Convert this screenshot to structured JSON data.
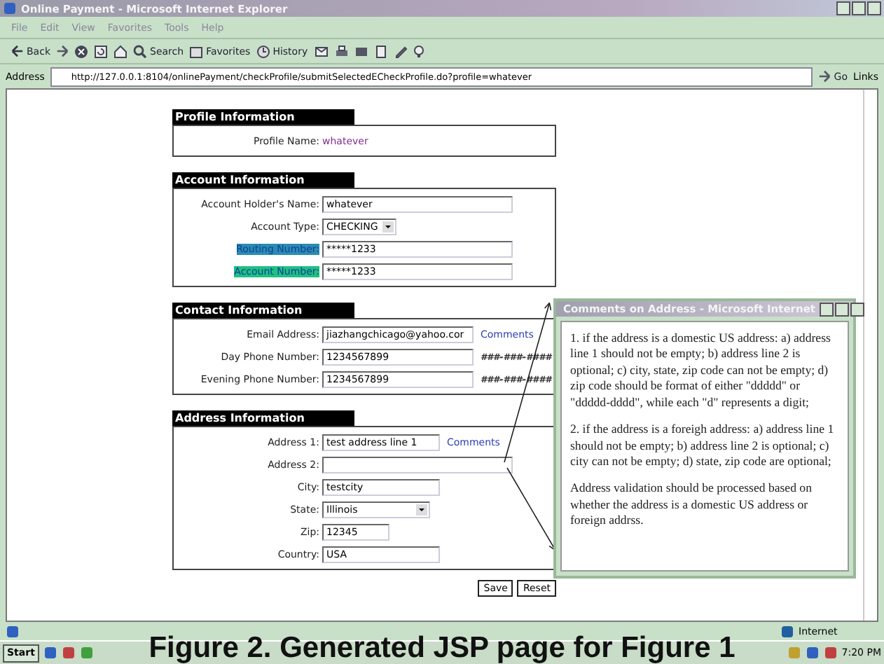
{
  "window": {
    "title": "Online Payment - Microsoft Internet Explorer"
  },
  "menu": [
    "File",
    "Edit",
    "View",
    "Favorites",
    "Tools",
    "Help"
  ],
  "toolbar": [
    {
      "kind": "back",
      "label": "Back"
    },
    {
      "kind": "forward"
    },
    {
      "kind": "stop"
    },
    {
      "kind": "refresh"
    },
    {
      "kind": "home"
    },
    {
      "kind": "search",
      "label": "Search"
    },
    {
      "kind": "favorites",
      "label": "Favorites"
    },
    {
      "kind": "history",
      "label": "History"
    },
    {
      "kind": "mail"
    },
    {
      "kind": "print"
    },
    {
      "kind": "edit"
    },
    {
      "kind": "discuss"
    },
    {
      "kind": "messenger"
    },
    {
      "kind": "tool"
    }
  ],
  "address_bar": {
    "label": "Address",
    "url": "http://127.0.0.1:8104/onlinePayment/checkProfile/submitSelectedECheckProfile.do?profile=whatever",
    "go": "Go",
    "links": "Links"
  },
  "sections": [
    {
      "title": "Profile Information",
      "fields": [
        {
          "kind": "static",
          "label": "Profile Name:",
          "value": "whatever"
        }
      ]
    },
    {
      "title": "Account Information",
      "fields": [
        {
          "kind": "long-input",
          "label": "Account Holder's Name:",
          "value": "whatever"
        },
        {
          "kind": "select",
          "label": "Account Type:",
          "value": "CHECKING"
        },
        {
          "kind": "long-input",
          "label": "Routing Number:",
          "value": "*****1233",
          "color": "#2a8cb0"
        },
        {
          "kind": "long-input",
          "label": "Account Number:",
          "value": "*****1233",
          "color": "#20c080"
        }
      ]
    },
    {
      "title": "Contact Information",
      "fields": [
        {
          "kind": "medium-input",
          "label": "Email Address:",
          "value": "jiazhangchicago@yahoo.cor",
          "link": "Comments"
        },
        {
          "kind": "medium-input",
          "label": "Day Phone Number:",
          "value": "1234567899",
          "hint": "###-###-####"
        },
        {
          "kind": "medium-input",
          "label": "Evening Phone Number:",
          "value": "1234567899",
          "hint": "###-###-####"
        }
      ]
    },
    {
      "title": "Address Information",
      "fields": [
        {
          "kind": "short-input",
          "label": "Address 1:",
          "value": "test address line 1",
          "link": "Comments"
        },
        {
          "kind": "long-input",
          "label": "Address 2:"
        },
        {
          "kind": "short-input",
          "label": "City:",
          "value": "testcity"
        },
        {
          "kind": "wide-select",
          "label": "State:",
          "value": "Illinois"
        },
        {
          "kind": "tiny-input",
          "label": "Zip:",
          "value": "12345"
        },
        {
          "kind": "short-input",
          "label": "Country:",
          "value": "USA"
        }
      ]
    }
  ],
  "buttons": [
    "Save",
    "Reset"
  ],
  "popup": {
    "title": "Comments on Address - Microsoft Internet",
    "paragraphs": [
      "1. if the address is a domestic US address: a) address line 1 should not be empty; b) address line 2 is optional; c) city, state, zip code can not be empty; d) zip code should be format of either \"ddddd\" or \"ddddd-dddd\", while each \"d\" represents a digit;",
      "2. if the address is a foreigh address: a) address line 1 should not be empty; b) address line 2 is optional; c) city can not be empty; d) state, zip code are optional;",
      "Address validation should be processed based on whether the address is a domestic US address or foreign addrss."
    ]
  },
  "status_bar": {
    "zone": "Internet"
  },
  "taskbar": {
    "start": "Start",
    "clock": "7:20 PM"
  },
  "caption": "Figure 2. Generated JSP page for Figure 1"
}
